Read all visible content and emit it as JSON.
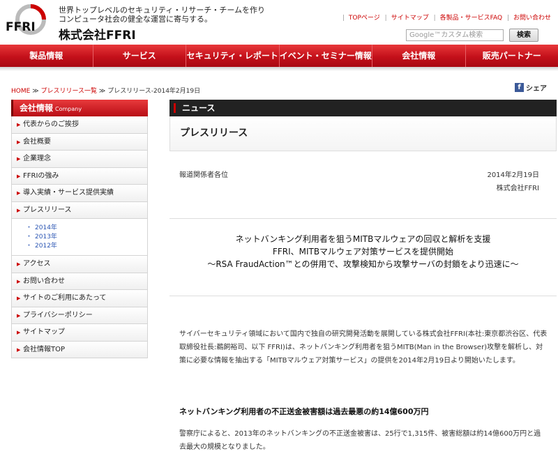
{
  "header": {
    "logo_text": "FFRI",
    "tagline_line1": "世界トップレベルのセキュリティ・リサーチ・チームを作り",
    "tagline_line2": "コンピュータ社会の健全な運営に寄与する。",
    "company_name": "株式会社FFRI",
    "top_links": [
      "TOPページ",
      "サイトマップ",
      "各製品・サービスFAQ",
      "お問い合わせ"
    ],
    "search_placeholder": "Google™カスタム検索",
    "search_button": "検索"
  },
  "nav": {
    "items": [
      "製品情報",
      "サービス",
      "セキュリティ・レポート",
      "イベント・セミナー情報",
      "会社情報",
      "販売パートナー"
    ]
  },
  "breadcrumb": {
    "home": "HOME",
    "sep1": "≫",
    "list": "プレスリリース一覧",
    "sep2": "≫",
    "current": "プレスリリース-2014年2月19日"
  },
  "share": {
    "label": "シェア",
    "fb_glyph": "f"
  },
  "sidebar": {
    "head": "会社情報",
    "head_en": "Company",
    "items_top": [
      "代表からのご挨拶",
      "会社概要",
      "企業理念",
      "FFRIの強み",
      "導入実績・サービス提供実績",
      "プレスリリース"
    ],
    "years": [
      "2014年",
      "2013年",
      "2012年"
    ],
    "items_bottom": [
      "アクセス",
      "お問い合わせ",
      "サイトのご利用にあたって",
      "プライバシーポリシー",
      "サイトマップ",
      "会社情報TOP"
    ]
  },
  "main": {
    "news_label": "ニュース",
    "pr_title": "プレスリリース",
    "addressee": "報道関係者各位",
    "date": "2014年2月19日",
    "signature": "株式会社FFRI",
    "headline1": "ネットバンキング利用者を狙うMITBマルウェアの回収と解析を支援",
    "headline2": "FFRI、MITBマルウェア対策サービスを提供開始",
    "headline3": "～RSA FraudAction™との併用で、攻撃検知から攻撃サーバの封鎖をより迅速に～",
    "body1": "サイバーセキュリティ領域において国内で独自の研究開発活動を展開している株式会社FFRI(本社:東京都渋谷区、代表取締役社長:鵜飼裕司、以下 FFRI)は、ネットバンキング利用者を狙うMITB(Man in the Browser)攻撃を解析し、対策に必要な情報を抽出する「MITBマルウェア対策サービス」の提供を2014年2月19日より開始いたします。",
    "subheading": "ネットバンキング利用者の不正送金被害額は過去最悪の約14億600万円",
    "body2": "警察庁によると、2013年のネットバンキングの不正送金被害は、25行で1,315件、被害総額は約14億600万円と過去最大の規模となりました。"
  }
}
